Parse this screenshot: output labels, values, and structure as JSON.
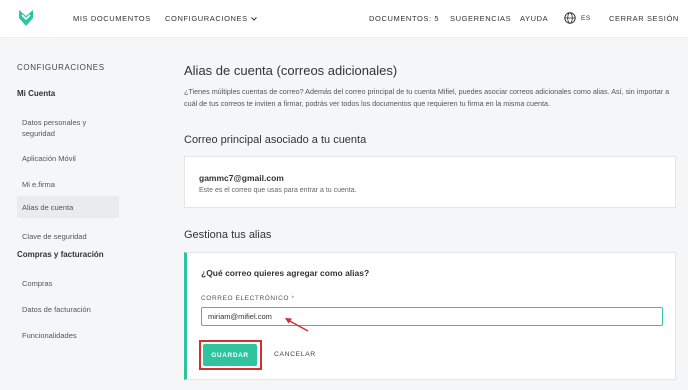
{
  "header": {
    "nav_documents": "MIS DOCUMENTOS",
    "nav_settings": "CONFIGURACIONES",
    "nav_doc_count": "DOCUMENTOS: 5",
    "nav_suggestions": "SUGERENCIAS",
    "nav_help": "AYUDA",
    "language": "ES",
    "nav_logout": "CERRAR SESIÓN"
  },
  "sidebar": {
    "heading": "CONFIGURACIONES",
    "section_account": "Mi Cuenta",
    "account_items": [
      {
        "label": "Datos personales y seguridad"
      },
      {
        "label": "Aplicación Móvil"
      },
      {
        "label": "Mi e.firma"
      },
      {
        "label": "Alias de cuenta"
      },
      {
        "label": "Clave de seguridad"
      }
    ],
    "section_billing": "Compras y facturación",
    "billing_items": [
      {
        "label": "Compras"
      },
      {
        "label": "Datos de facturación"
      },
      {
        "label": "Funcionalidades"
      }
    ]
  },
  "main": {
    "title": "Alias de cuenta (correos adicionales)",
    "description": "¿Tienes múltiples cuentas de correo? Además del correo principal de tu cuenta Mifiel, puedes asociar correos adicionales como alias. Así, sin importar a cuál de tus correos te inviten a firmar, podrás ver todos los documentos que requieren tu firma en la misma cuenta.",
    "primary_title": "Correo principal asociado a tu cuenta",
    "primary_email": "gammc7@gmail.com",
    "primary_note": "Este es el correo que usas para entrar a tu cuenta.",
    "manage_title": "Gestiona tus alias",
    "question": "¿Qué correo quieres agregar como alias?",
    "email_label": "CORREO ELECTRÓNICO",
    "required_mark": "*",
    "email_value": "miriam@mifiel.com",
    "save_label": "GUARDAR",
    "cancel_label": "CANCELAR"
  },
  "colors": {
    "accent": "#2ec4a0",
    "highlight": "#d32f2f"
  }
}
